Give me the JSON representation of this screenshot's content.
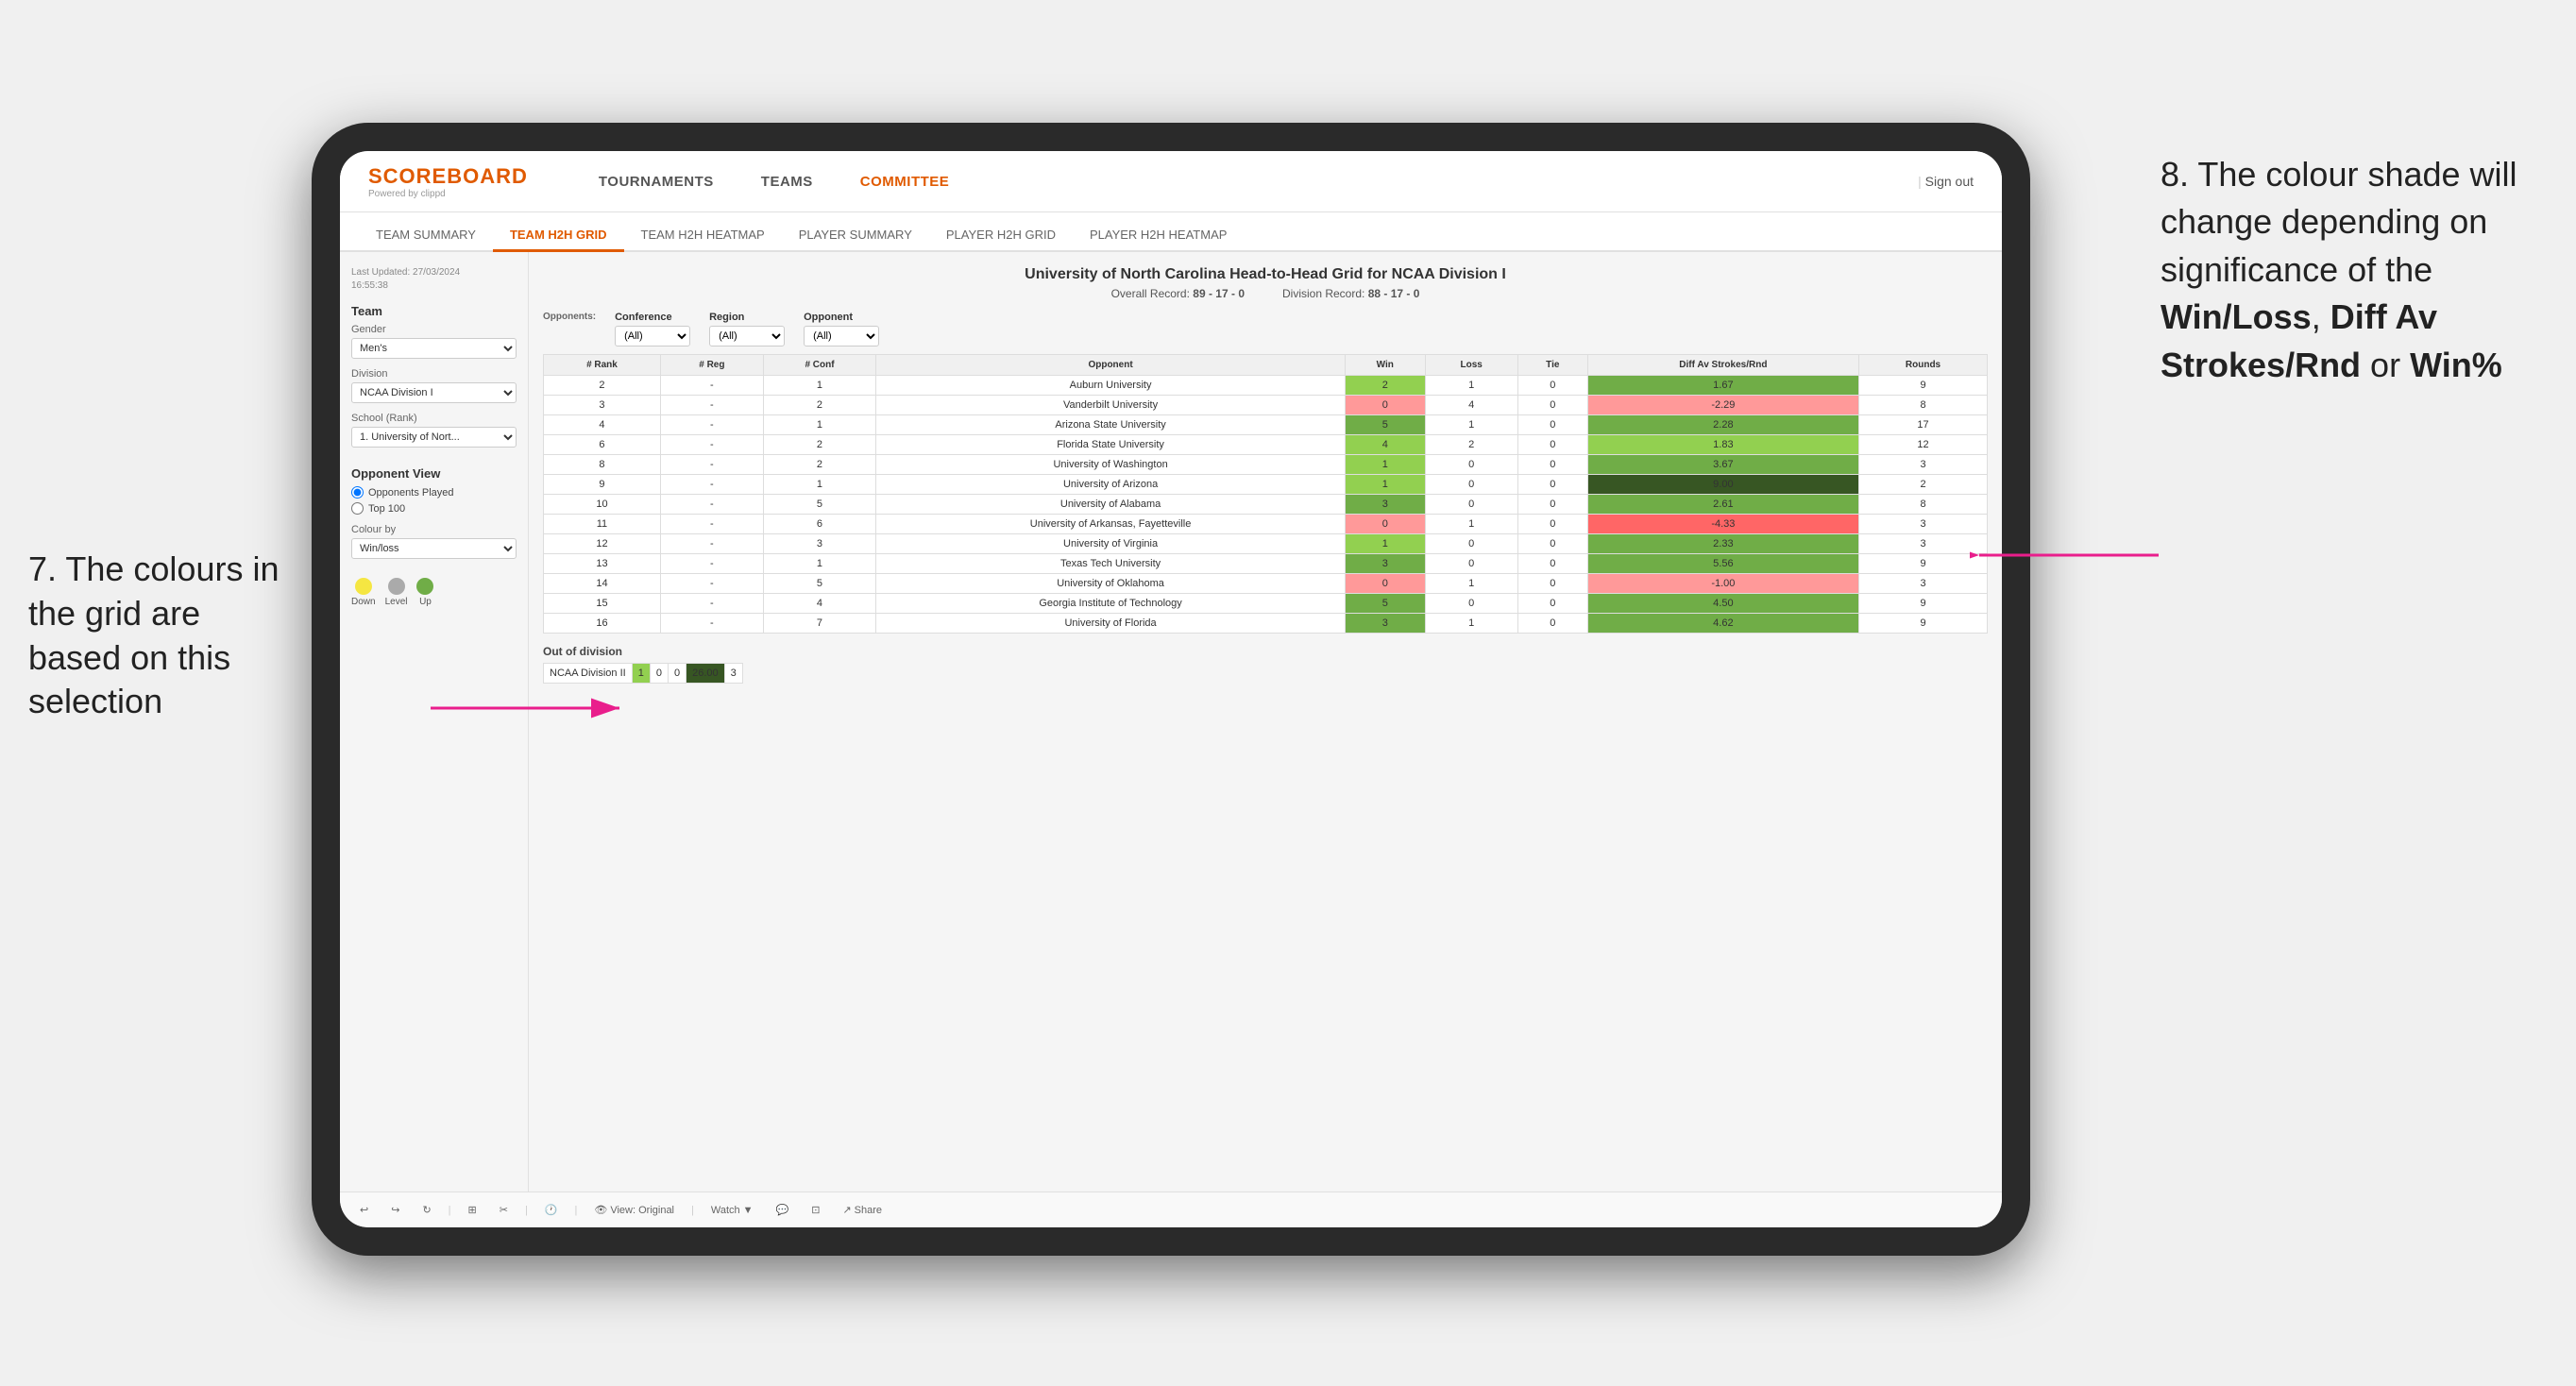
{
  "annotation_left": {
    "text": "7. The colours in the grid are based on this selection"
  },
  "annotation_right": {
    "line1": "8. The colour shade will change depending on significance of the ",
    "bold1": "Win/Loss",
    "sep1": ", ",
    "bold2": "Diff Av Strokes/Rnd",
    "sep2": " or ",
    "bold3": "Win%"
  },
  "header": {
    "logo": "SCOREBOARD",
    "logo_sub": "Powered by clippd",
    "nav_items": [
      "TOURNAMENTS",
      "TEAMS",
      "COMMITTEE"
    ],
    "sign_out": "Sign out"
  },
  "sub_nav": {
    "tabs": [
      "TEAM SUMMARY",
      "TEAM H2H GRID",
      "TEAM H2H HEATMAP",
      "PLAYER SUMMARY",
      "PLAYER H2H GRID",
      "PLAYER H2H HEATMAP"
    ]
  },
  "left_panel": {
    "timestamp_label": "Last Updated: 27/03/2024",
    "timestamp_time": "16:55:38",
    "team_section": "Team",
    "gender_label": "Gender",
    "gender_value": "Men's",
    "division_label": "Division",
    "division_value": "NCAA Division I",
    "school_label": "School (Rank)",
    "school_value": "1. University of Nort...",
    "opponent_view_label": "Opponent View",
    "opponents_played": "Opponents Played",
    "top_100": "Top 100",
    "colour_by_label": "Colour by",
    "colour_by_value": "Win/loss",
    "colour_down": "Down",
    "colour_level": "Level",
    "colour_up": "Up"
  },
  "grid": {
    "title": "University of North Carolina Head-to-Head Grid for NCAA Division I",
    "overall_record_label": "Overall Record:",
    "overall_record": "89 - 17 - 0",
    "division_record_label": "Division Record:",
    "division_record": "88 - 17 - 0",
    "filter_opponents_label": "Opponents:",
    "filter_conference_label": "Conference",
    "filter_conference_value": "(All)",
    "filter_region_label": "Region",
    "filter_region_value": "(All)",
    "filter_opponent_label": "Opponent",
    "filter_opponent_value": "(All)",
    "columns": [
      "# Rank",
      "# Reg",
      "# Conf",
      "Opponent",
      "Win",
      "Loss",
      "Tie",
      "Diff Av Strokes/Rnd",
      "Rounds"
    ],
    "rows": [
      {
        "rank": "2",
        "reg": "-",
        "conf": "1",
        "opponent": "Auburn University",
        "win": 2,
        "loss": 1,
        "tie": 0,
        "diff": "1.67",
        "rounds": 9,
        "win_color": "green_light",
        "loss_color": "white",
        "diff_color": "green_mid"
      },
      {
        "rank": "3",
        "reg": "-",
        "conf": "2",
        "opponent": "Vanderbilt University",
        "win": 0,
        "loss": 4,
        "tie": 0,
        "diff": "-2.29",
        "rounds": 8,
        "win_color": "red_light",
        "loss_color": "green_light",
        "diff_color": "red_light"
      },
      {
        "rank": "4",
        "reg": "-",
        "conf": "1",
        "opponent": "Arizona State University",
        "win": 5,
        "loss": 1,
        "tie": 0,
        "diff": "2.28",
        "rounds": 17,
        "win_color": "green_mid",
        "loss_color": "white",
        "diff_color": "green_mid"
      },
      {
        "rank": "6",
        "reg": "-",
        "conf": "2",
        "opponent": "Florida State University",
        "win": 4,
        "loss": 2,
        "tie": 0,
        "diff": "1.83",
        "rounds": 12,
        "win_color": "green_light",
        "loss_color": "white",
        "diff_color": "green_light"
      },
      {
        "rank": "8",
        "reg": "-",
        "conf": "2",
        "opponent": "University of Washington",
        "win": 1,
        "loss": 0,
        "tie": 0,
        "diff": "3.67",
        "rounds": 3,
        "win_color": "green_light",
        "loss_color": "white",
        "diff_color": "green_mid"
      },
      {
        "rank": "9",
        "reg": "-",
        "conf": "1",
        "opponent": "University of Arizona",
        "win": 1,
        "loss": 0,
        "tie": 0,
        "diff": "9.00",
        "rounds": 2,
        "win_color": "green_light",
        "loss_color": "white",
        "diff_color": "green_dark"
      },
      {
        "rank": "10",
        "reg": "-",
        "conf": "5",
        "opponent": "University of Alabama",
        "win": 3,
        "loss": 0,
        "tie": 0,
        "diff": "2.61",
        "rounds": 8,
        "win_color": "green_mid",
        "loss_color": "white",
        "diff_color": "green_mid"
      },
      {
        "rank": "11",
        "reg": "-",
        "conf": "6",
        "opponent": "University of Arkansas, Fayetteville",
        "win": 0,
        "loss": 1,
        "tie": 0,
        "diff": "-4.33",
        "rounds": 3,
        "win_color": "red_light",
        "loss_color": "white",
        "diff_color": "red_mid"
      },
      {
        "rank": "12",
        "reg": "-",
        "conf": "3",
        "opponent": "University of Virginia",
        "win": 1,
        "loss": 0,
        "tie": 0,
        "diff": "2.33",
        "rounds": 3,
        "win_color": "green_light",
        "loss_color": "white",
        "diff_color": "green_mid"
      },
      {
        "rank": "13",
        "reg": "-",
        "conf": "1",
        "opponent": "Texas Tech University",
        "win": 3,
        "loss": 0,
        "tie": 0,
        "diff": "5.56",
        "rounds": 9,
        "win_color": "green_mid",
        "loss_color": "white",
        "diff_color": "green_mid"
      },
      {
        "rank": "14",
        "reg": "-",
        "conf": "5",
        "opponent": "University of Oklahoma",
        "win": 0,
        "loss": 1,
        "tie": 0,
        "diff": "-1.00",
        "rounds": 3,
        "win_color": "red_light",
        "loss_color": "white",
        "diff_color": "red_light"
      },
      {
        "rank": "15",
        "reg": "-",
        "conf": "4",
        "opponent": "Georgia Institute of Technology",
        "win": 5,
        "loss": 0,
        "tie": 0,
        "diff": "4.50",
        "rounds": 9,
        "win_color": "green_mid",
        "loss_color": "white",
        "diff_color": "green_mid"
      },
      {
        "rank": "16",
        "reg": "-",
        "conf": "7",
        "opponent": "University of Florida",
        "win": 3,
        "loss": 1,
        "tie": 0,
        "diff": "4.62",
        "rounds": 9,
        "win_color": "green_mid",
        "loss_color": "white",
        "diff_color": "green_mid"
      }
    ],
    "out_of_division_label": "Out of division",
    "out_of_division_rows": [
      {
        "opponent": "NCAA Division II",
        "win": 1,
        "loss": 0,
        "tie": 0,
        "diff": "26.00",
        "rounds": 3,
        "win_color": "green_light",
        "diff_color": "green_dark"
      }
    ]
  },
  "bottom_toolbar": {
    "view_label": "View: Original",
    "watch_label": "Watch",
    "share_label": "Share"
  }
}
